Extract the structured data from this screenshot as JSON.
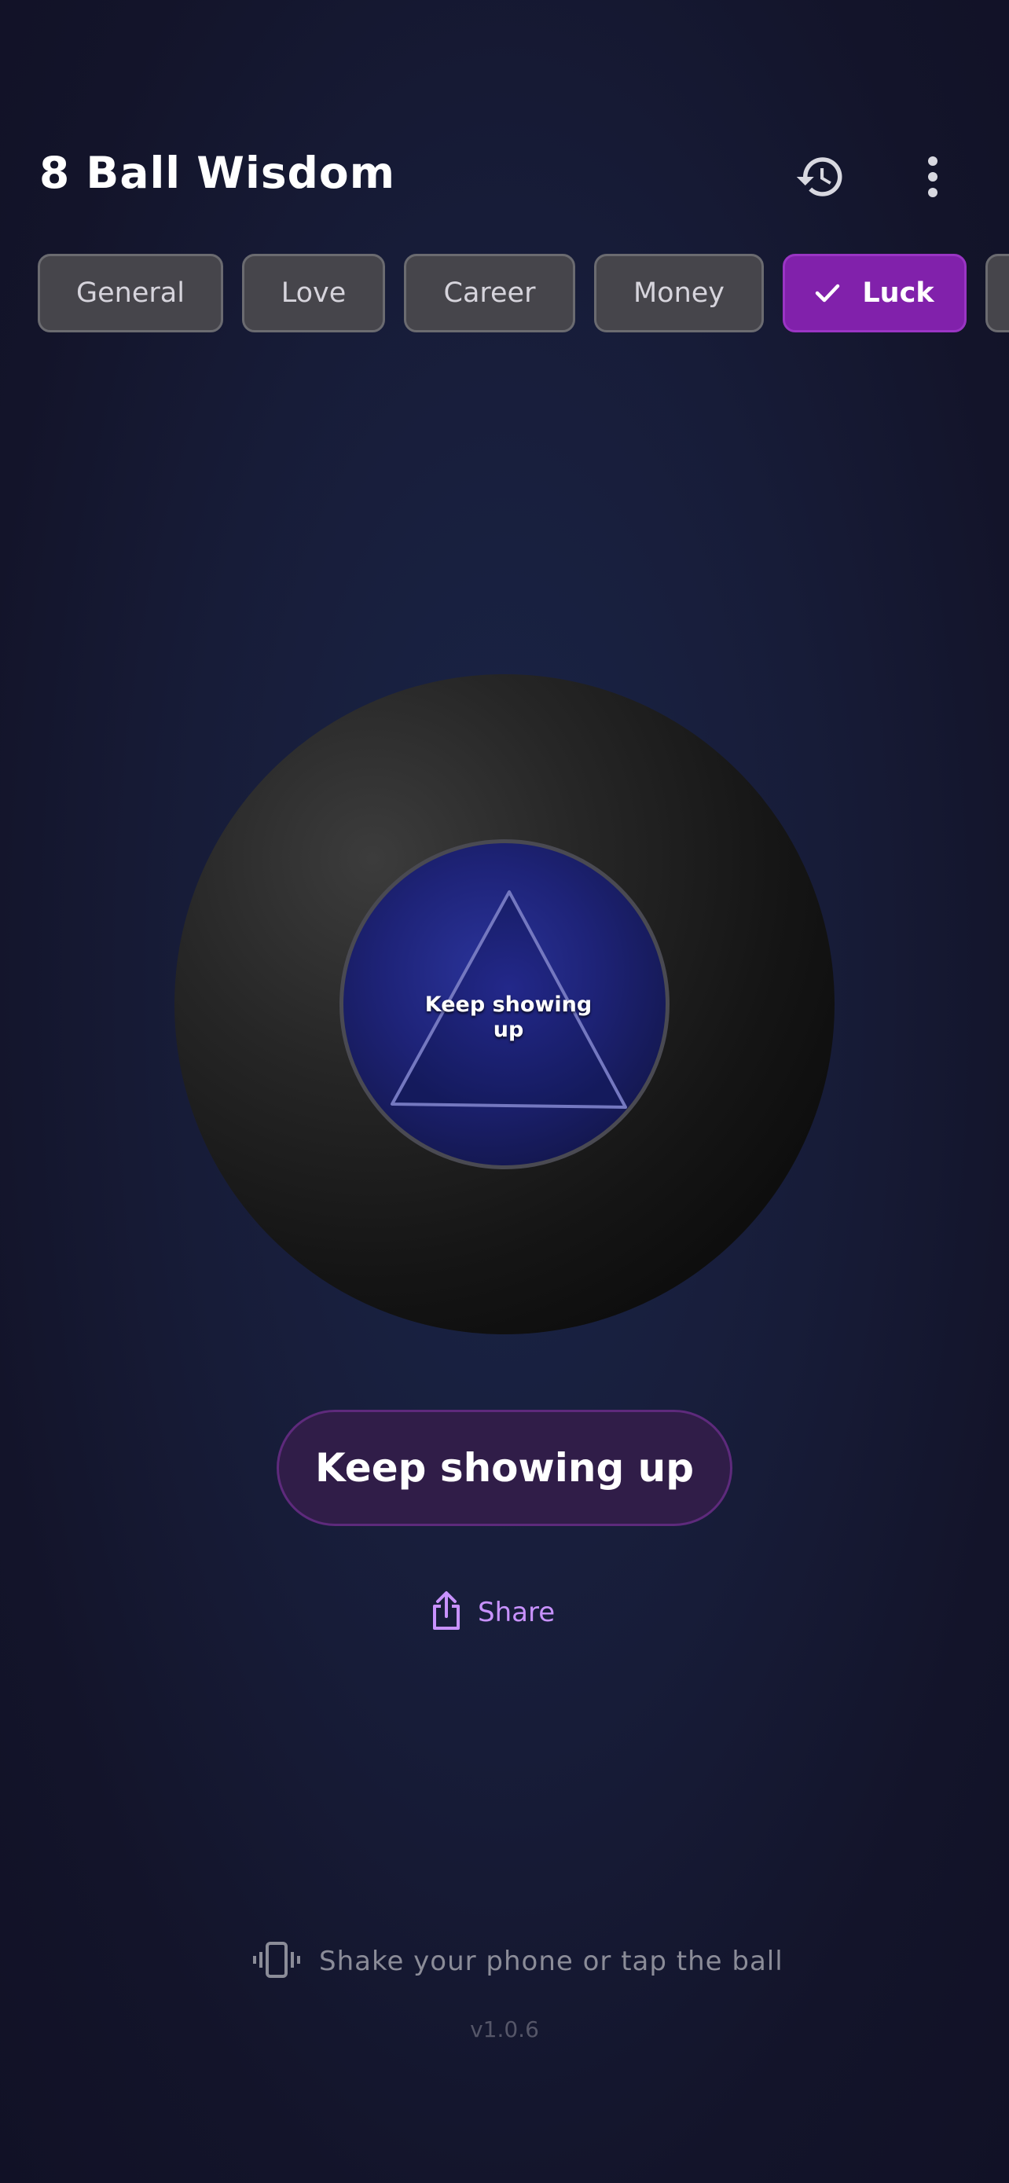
{
  "header": {
    "title": "8 Ball Wisdom",
    "history_icon": "history-icon",
    "more_icon": "more-vertical-icon"
  },
  "categories": {
    "items": [
      {
        "label": "General",
        "selected": false
      },
      {
        "label": "Love",
        "selected": false
      },
      {
        "label": "Career",
        "selected": false
      },
      {
        "label": "Money",
        "selected": false
      },
      {
        "label": "Luck",
        "selected": true
      }
    ],
    "selected_icon": "check-icon"
  },
  "ball": {
    "answer": "Keep showing up"
  },
  "answer_pill": {
    "text": "Keep showing up"
  },
  "share": {
    "label": "Share",
    "icon": "share-icon"
  },
  "hint": {
    "text": "Shake your phone or tap the ball",
    "icon": "vibrate-icon"
  },
  "version": "v1.0.6",
  "colors": {
    "accent": "#8121ab",
    "share_text": "#c892ff",
    "chip_bg": "#46454b",
    "pill_bg": "#301d48"
  }
}
